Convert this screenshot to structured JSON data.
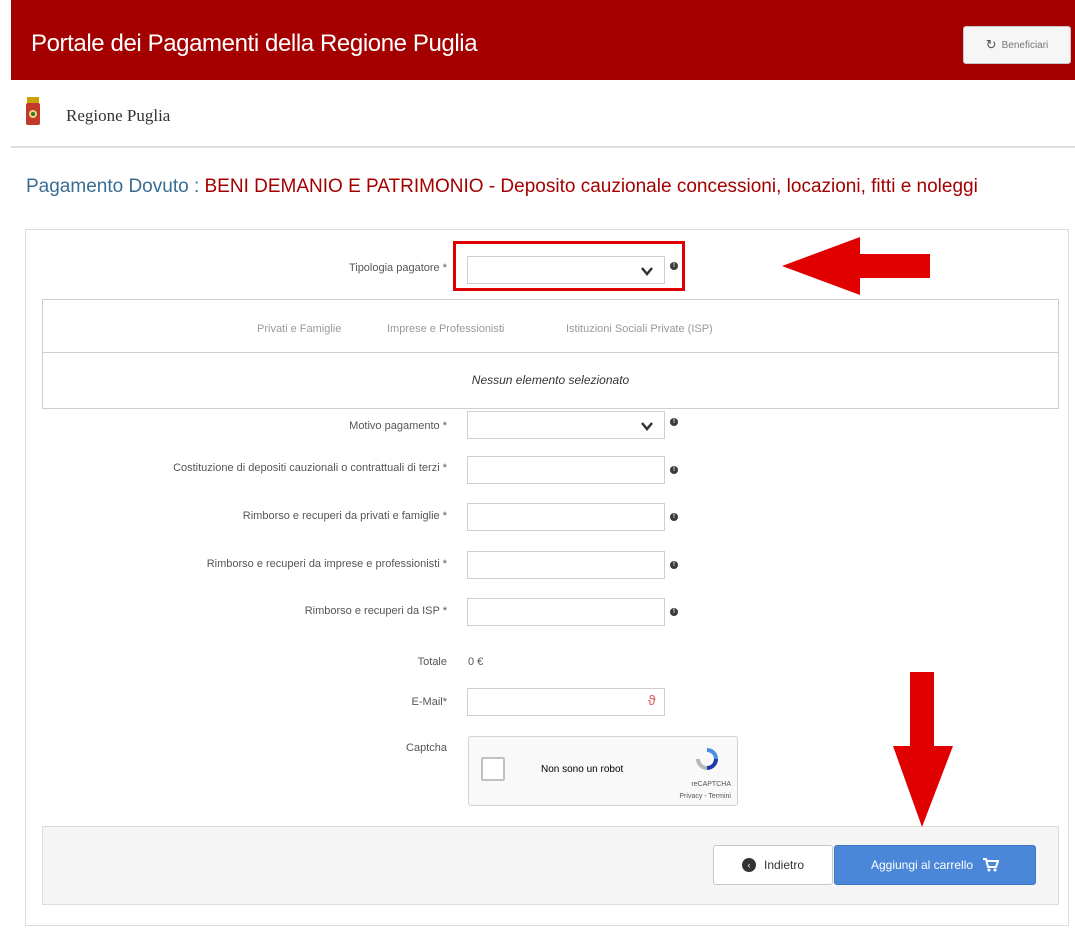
{
  "header": {
    "title": "Portale dei Pagamenti della Regione Puglia",
    "beneficiari_label": "Beneficiari"
  },
  "subheader": {
    "region_name": "Regione Puglia"
  },
  "page": {
    "title_prefix": "Pagamento Dovuto : ",
    "title_main": "BENI DEMANIO E PATRIMONIO - Deposito cauzionale concessioni, locazioni, fitti e noleggi"
  },
  "form": {
    "tipologia_label": "Tipologia pagatore *",
    "tabs": [
      "Privati e Famiglie",
      "Imprese e Professionisti",
      "Istituzioni Sociali Private (ISP)"
    ],
    "empty_message": "Nessun elemento selezionato",
    "motivo_label": "Motivo pagamento *",
    "fields": [
      {
        "label": "Costituzione di depositi cauzionali o contrattuali di terzi *",
        "value": ""
      },
      {
        "label": "Rimborso e recuperi da privati e famiglie *",
        "value": ""
      },
      {
        "label": "Rimborso e recuperi da imprese e professionisti *",
        "value": ""
      },
      {
        "label": "Rimborso e recuperi da ISP *",
        "value": ""
      }
    ],
    "totale_label": "Totale",
    "totale_value": "0 €",
    "email_label": "E-Mail*",
    "email_value": "",
    "captcha_label": "Captcha",
    "captcha_text": "Non sono un robot",
    "captcha_brand": "reCAPTCHA",
    "captcha_links": "Privacy - Termini"
  },
  "actions": {
    "back_label": "Indietro",
    "cart_label": "Aggiungi al carrello"
  },
  "colors": {
    "brand_red": "#a50000",
    "title_blue": "#3a6d94",
    "primary_button": "#4a87d9",
    "annotation_red": "#e10000"
  },
  "icons": {
    "beneficiari": "refresh-icon",
    "info": "info-icon",
    "back": "chevron-left-circle-icon",
    "cart": "cart-icon"
  }
}
